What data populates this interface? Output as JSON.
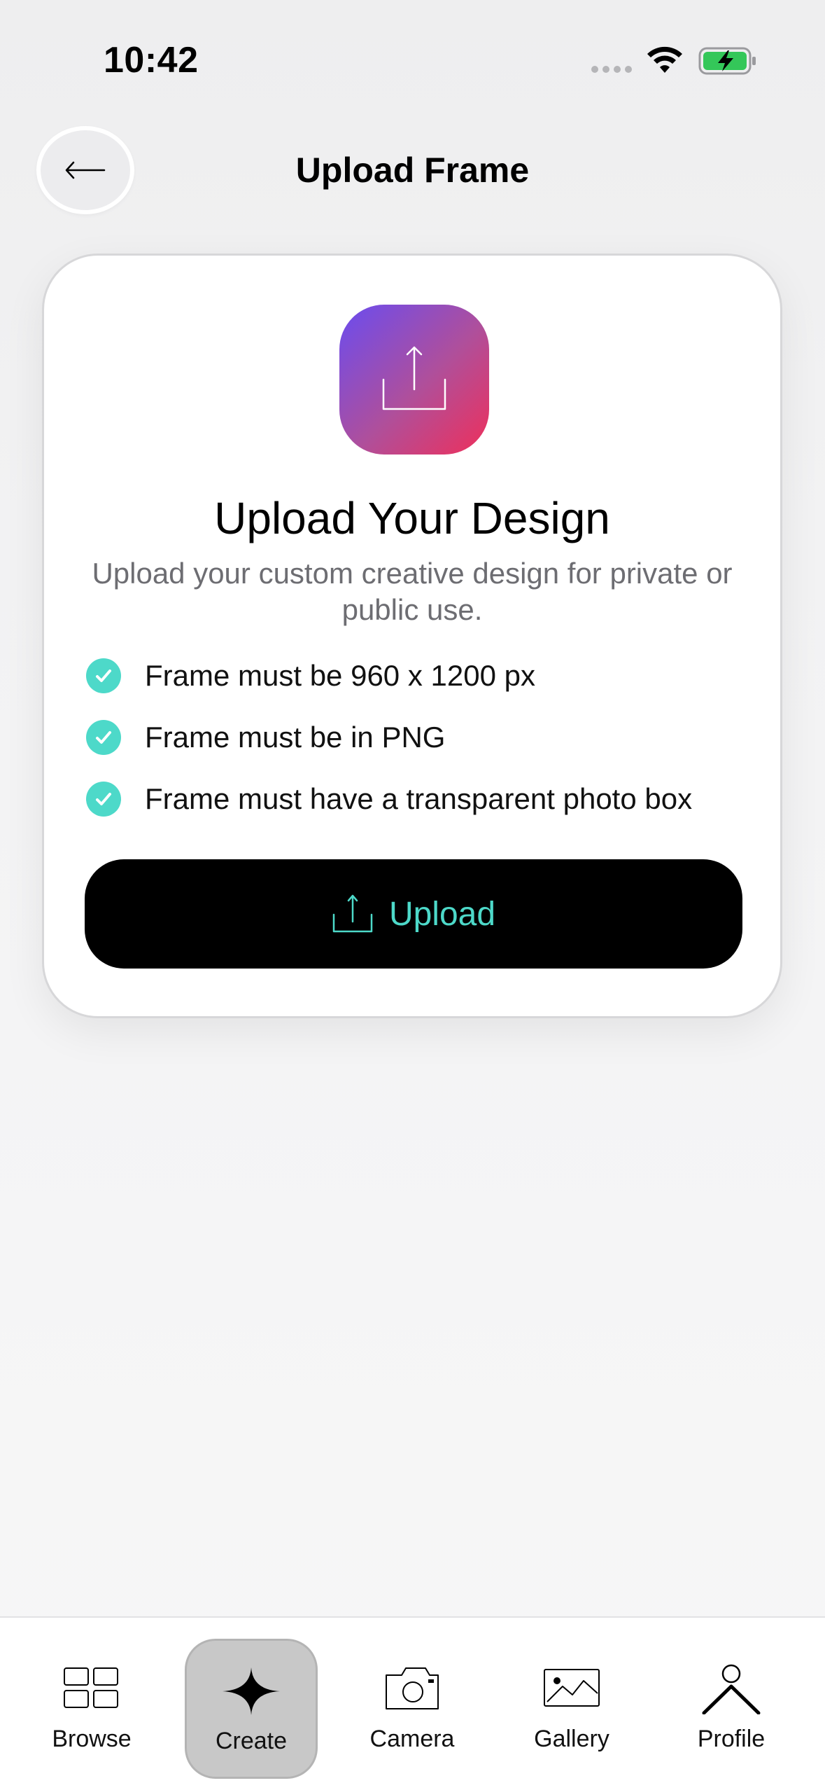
{
  "status_bar": {
    "time": "10:42"
  },
  "header": {
    "title": "Upload Frame",
    "back_icon": "back-arrow-icon"
  },
  "card": {
    "icon": "upload-icon",
    "title": "Upload Your Design",
    "subtitle": "Upload your custom creative design for private or public use.",
    "requirements": [
      "Frame must be 960 x 1200 px",
      "Frame must be in PNG",
      "Frame must have a transparent photo box"
    ],
    "upload_label": "Upload"
  },
  "tab_bar": {
    "tabs": [
      {
        "label": "Browse",
        "icon": "grid-icon"
      },
      {
        "label": "Create",
        "icon": "plus-icon",
        "active": true
      },
      {
        "label": "Camera",
        "icon": "camera-icon"
      },
      {
        "label": "Gallery",
        "icon": "image-icon"
      },
      {
        "label": "Profile",
        "icon": "person-icon"
      }
    ]
  },
  "colors": {
    "accent": "#4dd9c9",
    "icon_gradient_start": "#6a4cf0",
    "icon_gradient_end": "#ef2f5a",
    "button_bg": "#000000",
    "subtitle": "#6d6d72"
  }
}
